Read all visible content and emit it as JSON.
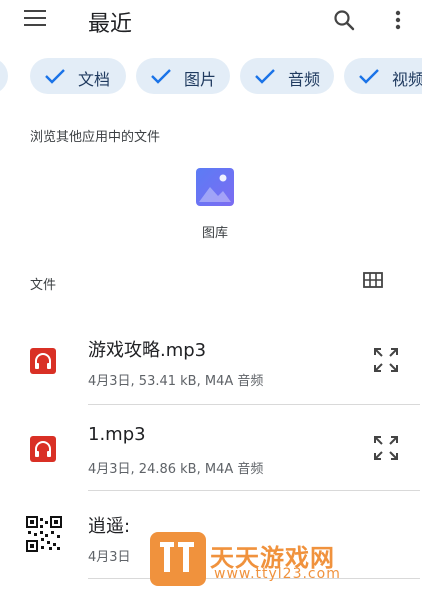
{
  "appbar": {
    "title": "最近",
    "menu_icon": "hamburger-menu-icon",
    "search_icon": "search-icon",
    "more_icon": "more-vert-icon"
  },
  "chips": [
    {
      "label": "文档",
      "icon": "check-icon"
    },
    {
      "label": "图片",
      "icon": "check-icon"
    },
    {
      "label": "音频",
      "icon": "check-icon"
    },
    {
      "label": "视频",
      "icon": "check-icon"
    }
  ],
  "browse_section": {
    "title": "浏览其他应用中的文件",
    "apps": [
      {
        "label": "图库",
        "icon": "gallery-icon"
      }
    ]
  },
  "files_section": {
    "title": "文件",
    "view_toggle_icon": "grid-view-icon"
  },
  "files": [
    {
      "name": "游戏攻略.mp3",
      "meta": "4月3日, 53.41 kB, M4A 音频",
      "icon": "audio-file-icon"
    },
    {
      "name": "1.mp3",
      "meta": "4月3日, 24.86 kB, M4A 音频",
      "icon": "audio-file-icon"
    },
    {
      "name": "逍遥:",
      "meta": "4月3日",
      "icon": "qr-code-icon"
    }
  ],
  "watermark": {
    "title": "天天游戏网",
    "url": "www.ttyl23.com"
  },
  "colors": {
    "chip_bg": "#e3edf7",
    "accent": "#1a73e8",
    "audio_icon": "#d93025",
    "watermark": "#f0923d"
  }
}
